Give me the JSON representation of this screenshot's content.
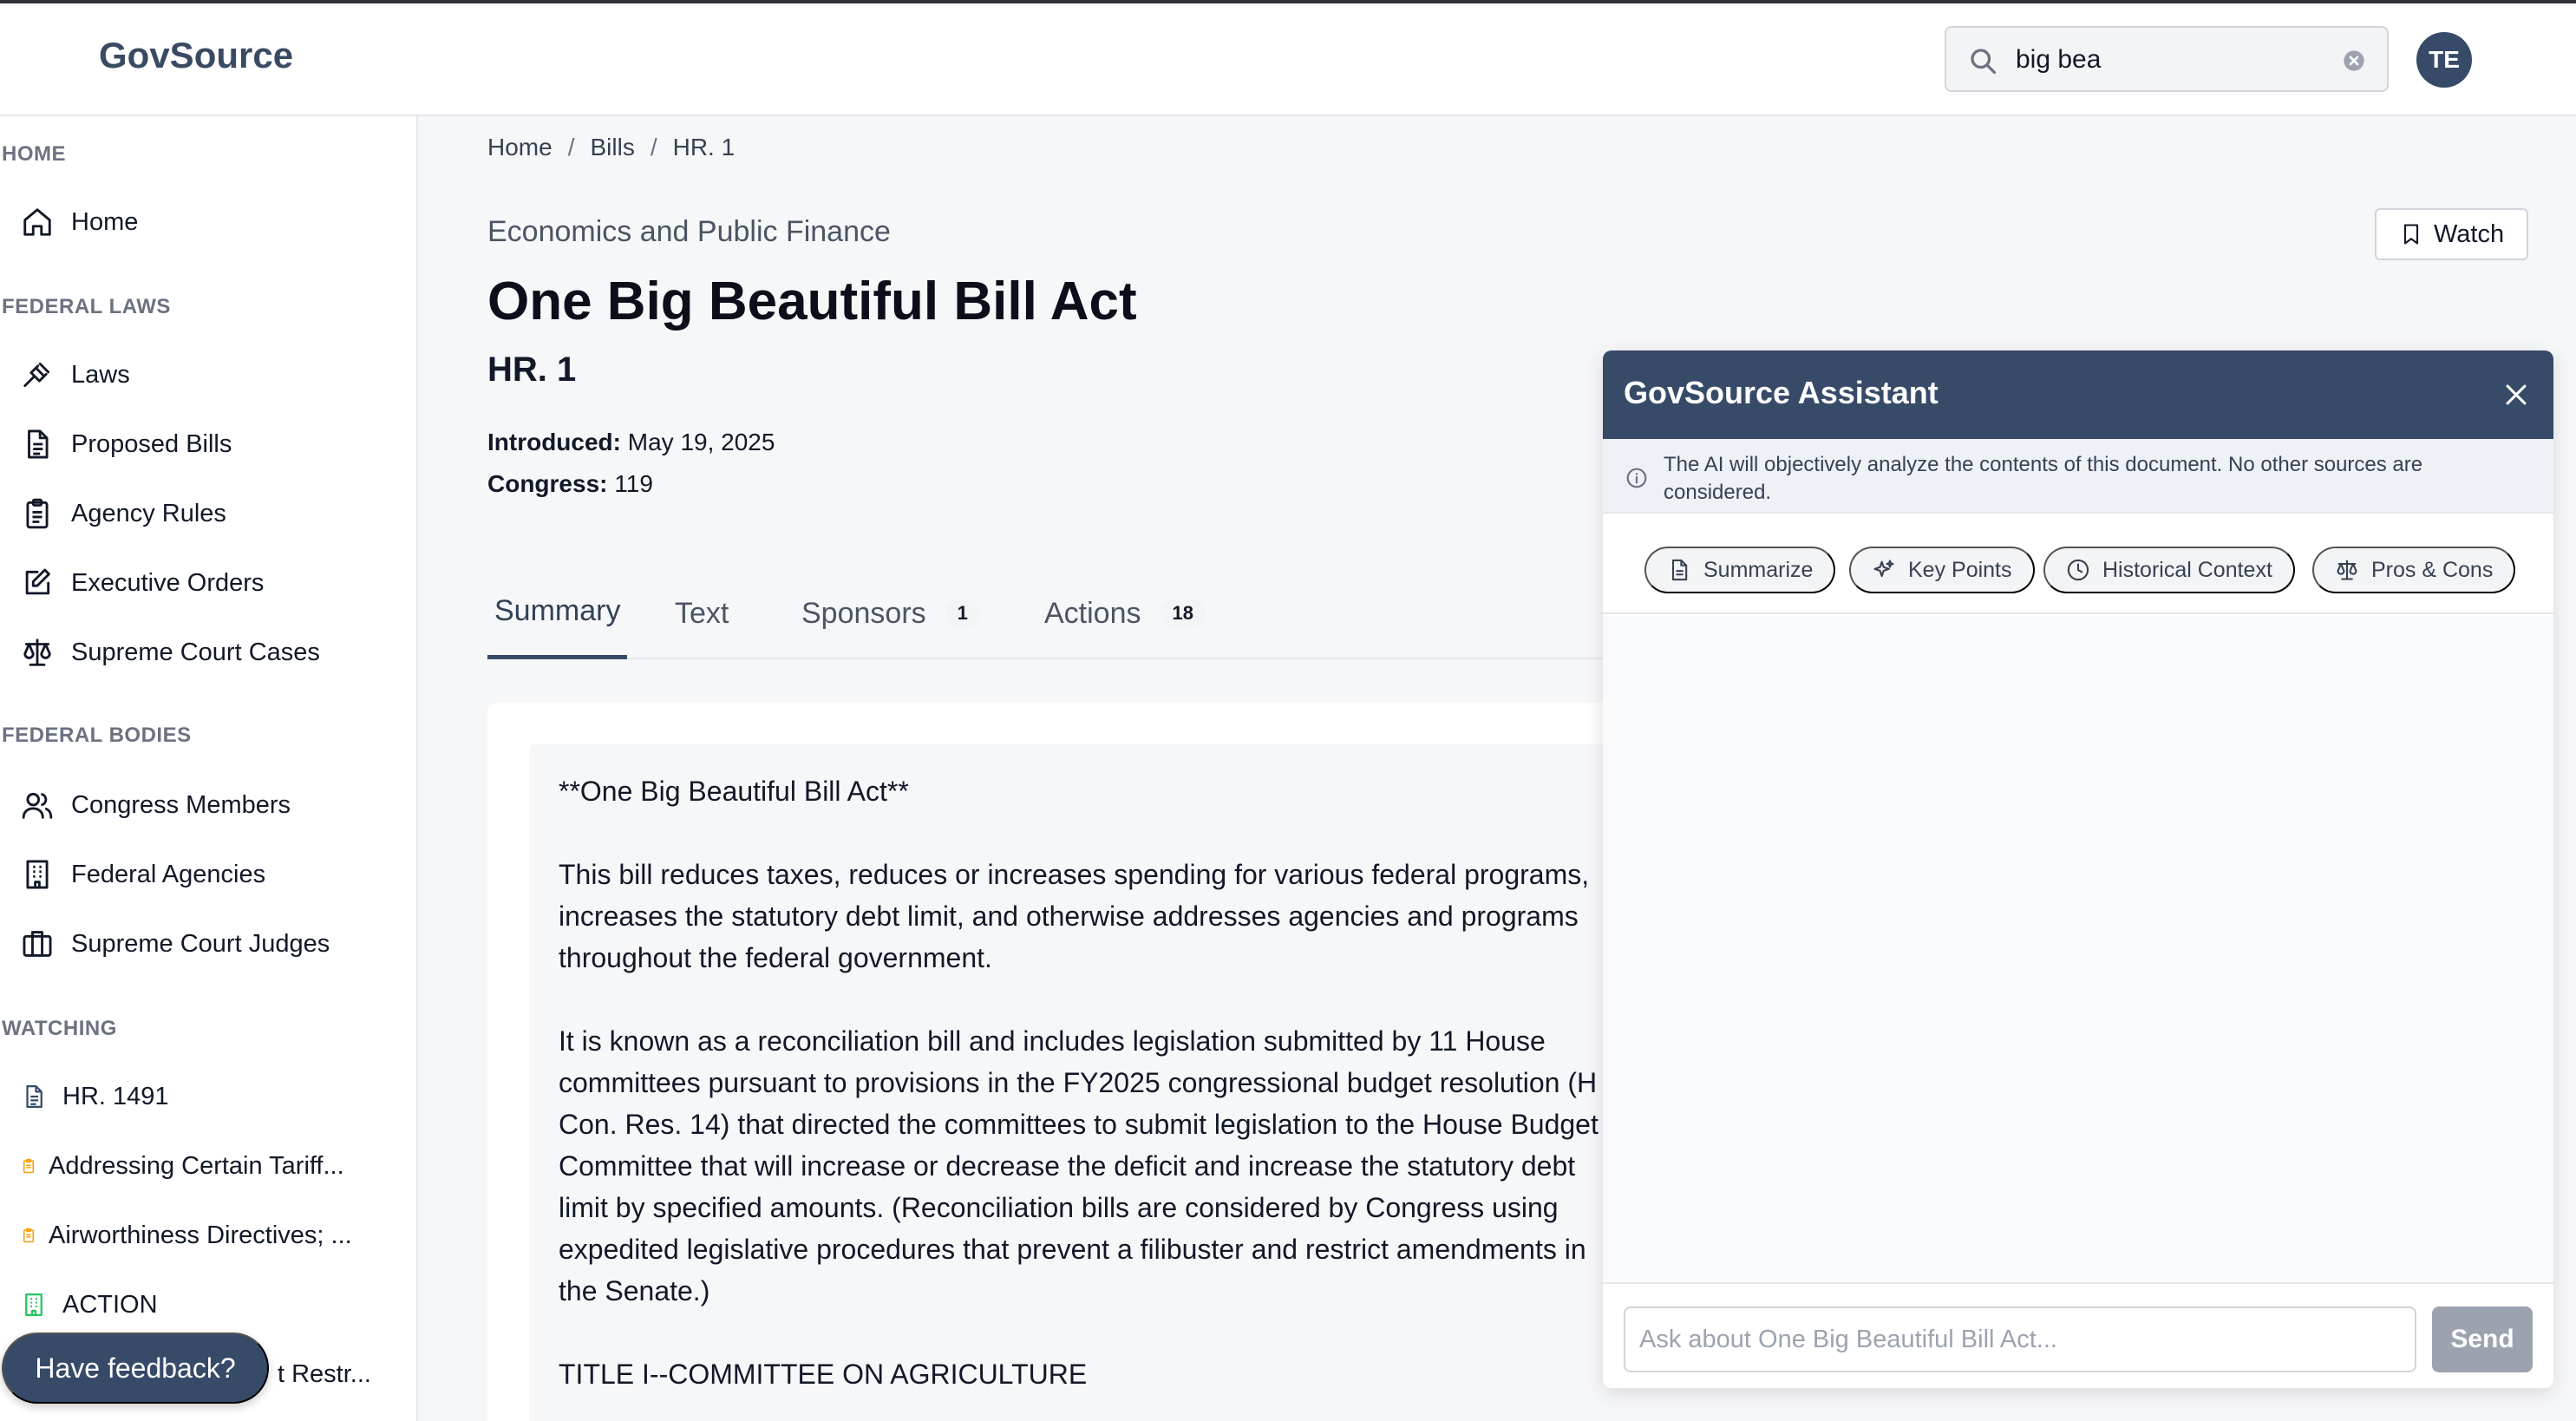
{
  "app": {
    "logo": "GovSource"
  },
  "search": {
    "value": "big bea",
    "placeholder": ""
  },
  "user": {
    "initials": "TE"
  },
  "sidebar": {
    "sections": [
      {
        "title": "HOME",
        "items": [
          {
            "label": "Home",
            "icon": "home-icon"
          }
        ]
      },
      {
        "title": "FEDERAL LAWS",
        "items": [
          {
            "label": "Laws",
            "icon": "gavel-icon"
          },
          {
            "label": "Proposed Bills",
            "icon": "document-icon"
          },
          {
            "label": "Agency Rules",
            "icon": "clipboard-icon"
          },
          {
            "label": "Executive Orders",
            "icon": "edit-icon"
          },
          {
            "label": "Supreme Court Cases",
            "icon": "scale-icon"
          }
        ]
      },
      {
        "title": "FEDERAL BODIES",
        "items": [
          {
            "label": "Congress Members",
            "icon": "users-icon"
          },
          {
            "label": "Federal Agencies",
            "icon": "building-icon"
          },
          {
            "label": "Supreme Court Judges",
            "icon": "briefcase-icon"
          }
        ]
      },
      {
        "title": "WATCHING",
        "items": [
          {
            "label": "HR. 1491",
            "icon": "document-icon"
          },
          {
            "label": "Addressing Certain Tariff...",
            "icon": "clipboard-icon"
          },
          {
            "label": "Airworthiness Directives; ...",
            "icon": "clipboard-icon"
          },
          {
            "label": "ACTION",
            "icon": "building-icon"
          },
          {
            "label": "t Restr...",
            "icon": ""
          }
        ]
      }
    ]
  },
  "breadcrumb": [
    "Home",
    "Bills",
    "HR. 1"
  ],
  "bill": {
    "category": "Economics and Public Finance",
    "title": "One Big Beautiful Bill Act",
    "number": "HR. 1",
    "introduced_label": "Introduced:",
    "introduced_value": "May 19, 2025",
    "congress_label": "Congress:",
    "congress_value": "119",
    "watch_label": "Watch"
  },
  "tabs": [
    {
      "label": "Summary",
      "count": ""
    },
    {
      "label": "Text",
      "count": ""
    },
    {
      "label": "Sponsors",
      "count": "1"
    },
    {
      "label": "Actions",
      "count": "18"
    }
  ],
  "summary": {
    "heading": "**One Big Beautiful Bill Act**",
    "para1": "This bill reduces taxes, reduces or increases spending for various federal programs, increases the statutory debt limit, and otherwise addresses agencies and programs throughout the federal government.",
    "para2": "It is known as a reconciliation bill and includes legislation submitted by 11 House committees pursuant to provisions in the FY2025 congressional budget resolution (H Con. Res. 14) that directed the committees to submit legislation to the House Budget Committee that will increase or decrease the deficit and increase the statutory debt limit by specified amounts. (Reconciliation bills are considered by Congress using expedited legislative procedures that prevent a filibuster and restrict amendments in the Senate.)",
    "title1": "TITLE I--COMMITTEE ON AGRICULTURE"
  },
  "assistant": {
    "title": "GovSource Assistant",
    "note": "The AI will objectively analyze the contents of this document. No other sources are considered.",
    "actions": [
      {
        "label": "Summarize",
        "icon": "document-icon"
      },
      {
        "label": "Key Points",
        "icon": "sparkles-icon"
      },
      {
        "label": "Historical Context",
        "icon": "clock-icon"
      },
      {
        "label": "Pros & Cons",
        "icon": "scale-icon"
      }
    ],
    "input_placeholder": "Ask about One Big Beautiful Bill Act...",
    "send_label": "Send"
  },
  "feedback": {
    "label": "Have feedback?"
  },
  "colors": {
    "brand": "#374a68",
    "accent_orange": "#f59e0b",
    "accent_green": "#22c55e"
  }
}
